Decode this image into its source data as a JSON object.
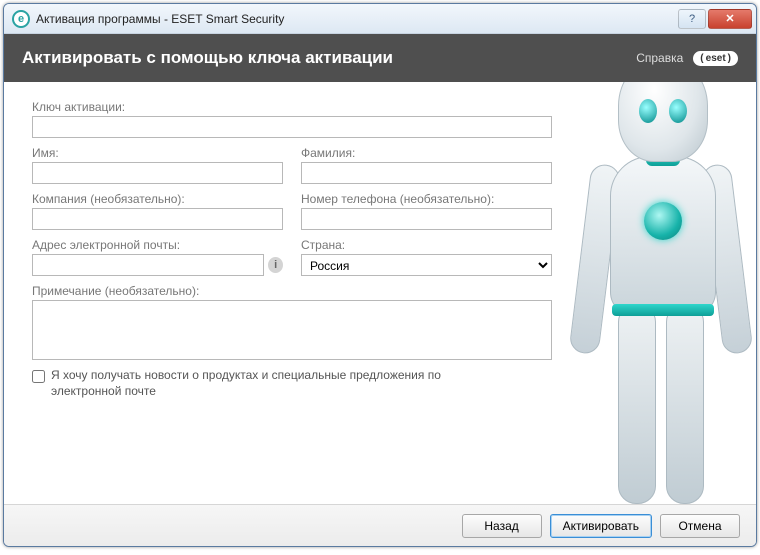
{
  "window": {
    "title": "Активация программы - ESET Smart Security",
    "icon_letter": "e"
  },
  "header": {
    "heading": "Активировать с помощью ключа активации",
    "help_label": "Справка",
    "brand": "eset"
  },
  "form": {
    "activation_key": {
      "label": "Ключ активации:",
      "value": ""
    },
    "first_name": {
      "label": "Имя:",
      "value": ""
    },
    "last_name": {
      "label": "Фамилия:",
      "value": ""
    },
    "company": {
      "label": "Компания (необязательно):",
      "value": ""
    },
    "phone": {
      "label": "Номер телефона (необязательно):",
      "value": ""
    },
    "email": {
      "label": "Адрес электронной почты:",
      "value": ""
    },
    "country": {
      "label": "Страна:",
      "selected": "Россия"
    },
    "note": {
      "label": "Примечание (необязательно):",
      "value": ""
    },
    "newsletter": {
      "label": "Я хочу получать новости о продуктах и специальные предложения по электронной почте",
      "checked": false
    }
  },
  "footer": {
    "back": "Назад",
    "activate": "Активировать",
    "cancel": "Отмена"
  }
}
